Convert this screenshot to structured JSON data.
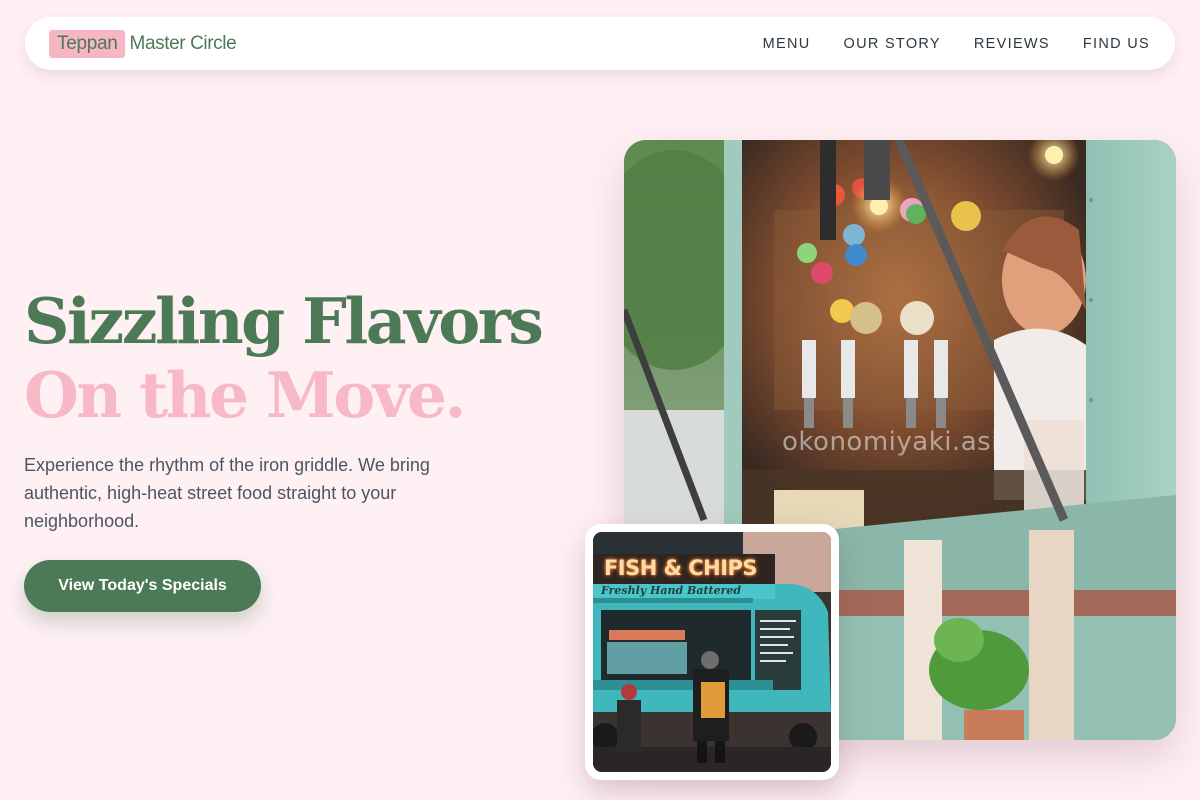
{
  "nav": {
    "brand_tag": "Teppan",
    "brand_name": "Master Circle",
    "links": [
      "MENU",
      "OUR STORY",
      "REVIEWS",
      "FIND US"
    ]
  },
  "hero": {
    "title_line1": "Sizzling Flavors",
    "title_line2": "On the Move.",
    "description": "Experience the rhythm of the iron griddle. We bring authentic, high-heat street food straight to your neighborhood.",
    "cta_label": "View Today's Specials"
  },
  "images": {
    "main_watermark": "okonomiyaki.asia",
    "secondary_sign": "FISH & CHIPS",
    "secondary_subsign": "Freshly Hand Battered"
  },
  "colors": {
    "background": "#fff0f4",
    "brand_green": "#4d7a56",
    "accent_pink": "#f7b9c6",
    "text_body": "#4b5563",
    "nav_text": "#2c3840"
  }
}
